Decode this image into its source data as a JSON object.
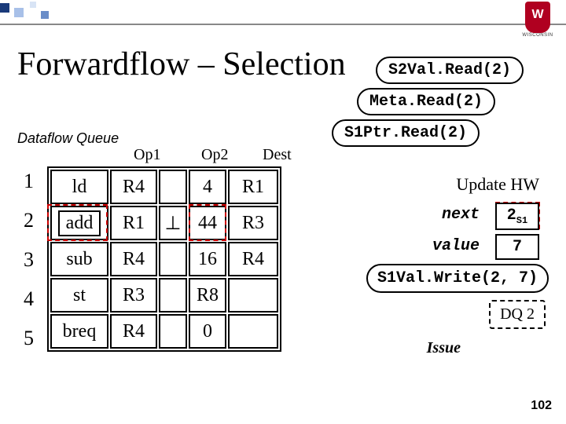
{
  "title": "Forwardflow – Selection",
  "logo": {
    "text": "WISCONSIN"
  },
  "callouts": {
    "s2val": "S2Val.Read(2)",
    "meta": "Meta.Read(2)",
    "s1ptr": "S1Ptr.Read(2)"
  },
  "dfq_label": "Dataflow Queue",
  "cols": {
    "op1": "Op1",
    "op2": "Op2",
    "dest": "Dest"
  },
  "rows": [
    {
      "idx": "1",
      "instr": "ld",
      "op1": "R4",
      "op2a": "",
      "op2b": "4",
      "dest": "R1"
    },
    {
      "idx": "2",
      "instr": "add",
      "op1": "R1",
      "op2a": "⊥",
      "op2b": "44",
      "dest": "R3"
    },
    {
      "idx": "3",
      "instr": "sub",
      "op1": "R4",
      "op2a": "",
      "op2b": "16",
      "dest": "R4"
    },
    {
      "idx": "4",
      "instr": "st",
      "op1": "R3",
      "op2a": "",
      "op2b": "R8",
      "dest": ""
    },
    {
      "idx": "5",
      "instr": "breq",
      "op1": "R4",
      "op2a": "",
      "op2b": "0",
      "dest": ""
    }
  ],
  "update_hw": "Update HW",
  "kv": {
    "next_label": "next",
    "next_value_main": "2",
    "next_value_sub": "S1",
    "value_label": "value",
    "value_value": "7"
  },
  "write_call": "S1Val.Write(2, 7)",
  "dq_box": "DQ 2",
  "issue": "Issue",
  "page": "102"
}
